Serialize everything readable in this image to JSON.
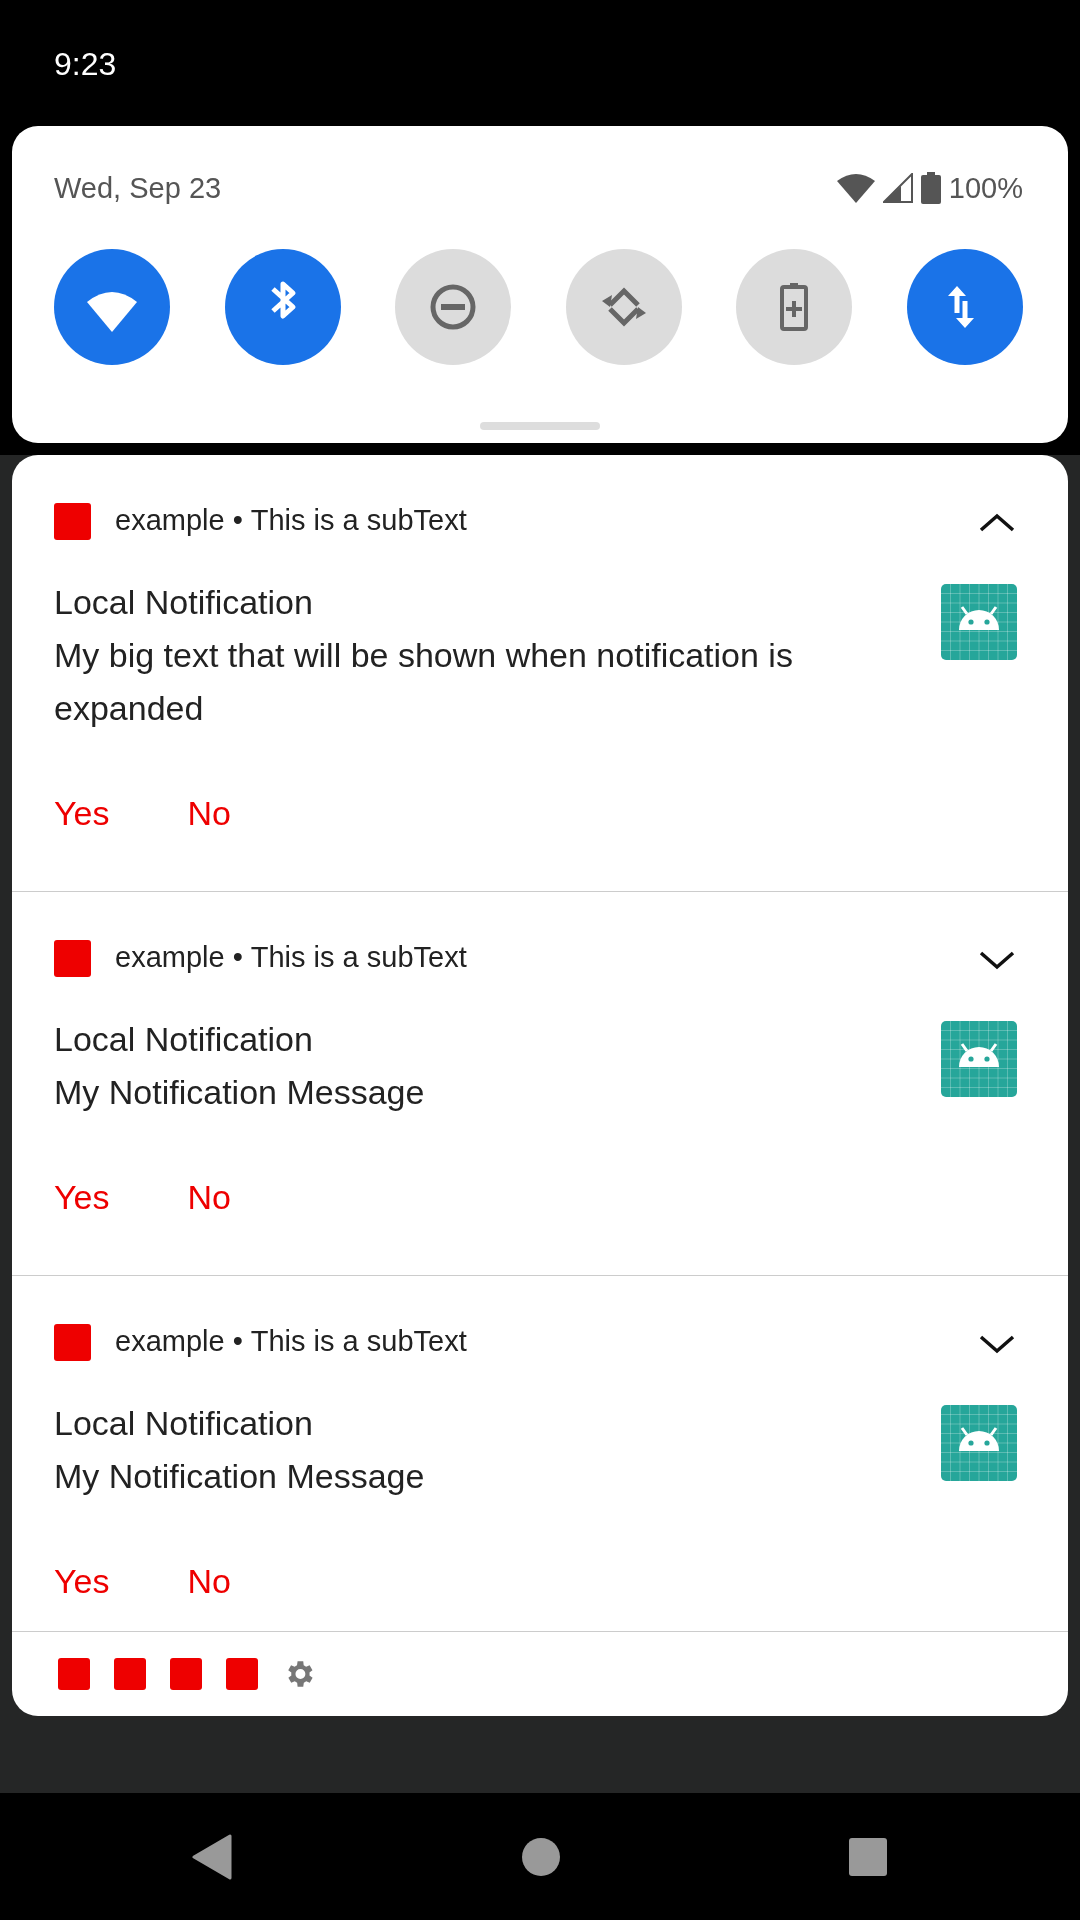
{
  "status_bar": {
    "time": "9:23"
  },
  "quick_settings": {
    "date": "Wed, Sep 23",
    "battery_level": "100%",
    "tiles": [
      {
        "kind": "wifi",
        "on": true
      },
      {
        "kind": "bluetooth",
        "on": true
      },
      {
        "kind": "dnd",
        "on": false
      },
      {
        "kind": "rotate",
        "on": false
      },
      {
        "kind": "battery_saver",
        "on": false
      },
      {
        "kind": "data",
        "on": true
      }
    ]
  },
  "notifications": [
    {
      "app": "example",
      "separator": "•",
      "sub_text": "This is a subText",
      "expanded": true,
      "title": "Local Notification",
      "text": "My big text that will be shown when notification is expanded",
      "actions": [
        "Yes",
        "No"
      ]
    },
    {
      "app": "example",
      "separator": "•",
      "sub_text": "This is a subText",
      "expanded": false,
      "title": "Local Notification",
      "text": "My Notification Message",
      "actions": [
        "Yes",
        "No"
      ]
    },
    {
      "app": "example",
      "separator": "•",
      "sub_text": "This is a subText",
      "expanded": false,
      "title": "Local Notification",
      "text": "My Notification Message",
      "actions": [
        "Yes",
        "No"
      ]
    }
  ],
  "footer_icons": [
    {
      "kind": "app"
    },
    {
      "kind": "app"
    },
    {
      "kind": "app"
    },
    {
      "kind": "app"
    },
    {
      "kind": "settings"
    }
  ]
}
